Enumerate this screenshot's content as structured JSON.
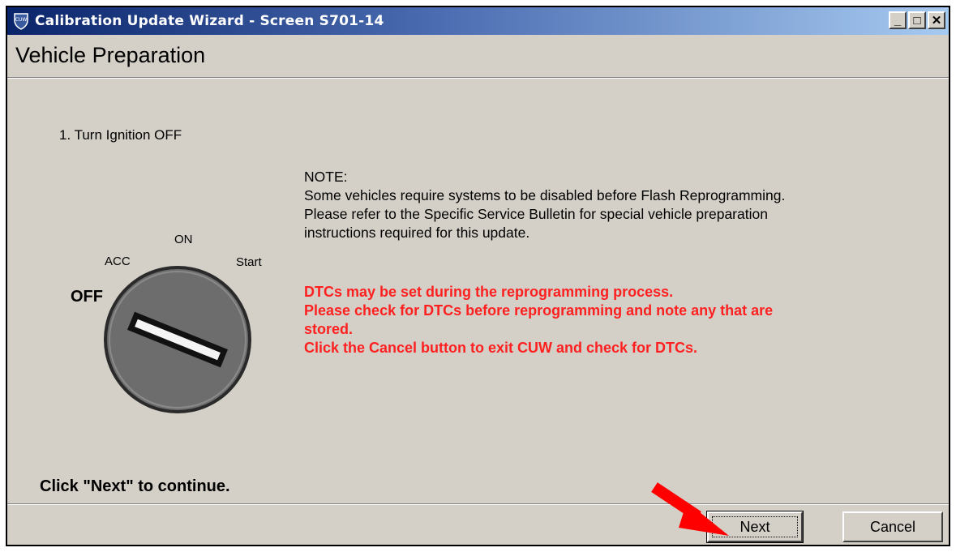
{
  "window": {
    "title": "Calibration Update Wizard - Screen S701-14",
    "icon_label": "CUW",
    "controls": {
      "minimize": "_",
      "maximize": "□",
      "close": "✕"
    }
  },
  "page": {
    "title": "Vehicle Preparation",
    "step": "1. Turn Ignition OFF",
    "note_heading": "NOTE:",
    "note_lines": [
      "Some vehicles require systems to be disabled before Flash Reprogramming.",
      "Please refer to the Specific Service Bulletin for special vehicle preparation",
      "instructions required for this update."
    ],
    "warning_lines": [
      "DTCs may be set during the reprogramming process.",
      "Please check for DTCs before reprogramming and note any that are",
      "stored.",
      "Click the Cancel button to exit CUW and check for DTCs."
    ],
    "footer_prompt": "Click \"Next\" to continue."
  },
  "ignition": {
    "labels": {
      "acc": "ACC",
      "on": "ON",
      "start": "Start",
      "off": "OFF"
    }
  },
  "buttons": {
    "next": "Next",
    "cancel": "Cancel"
  },
  "colors": {
    "window_bg": "#d4d0c8",
    "title_gradient_start": "#0a246a",
    "title_gradient_end": "#a6caf0",
    "warning_text": "#ff2020",
    "arrow": "#ff0000"
  }
}
